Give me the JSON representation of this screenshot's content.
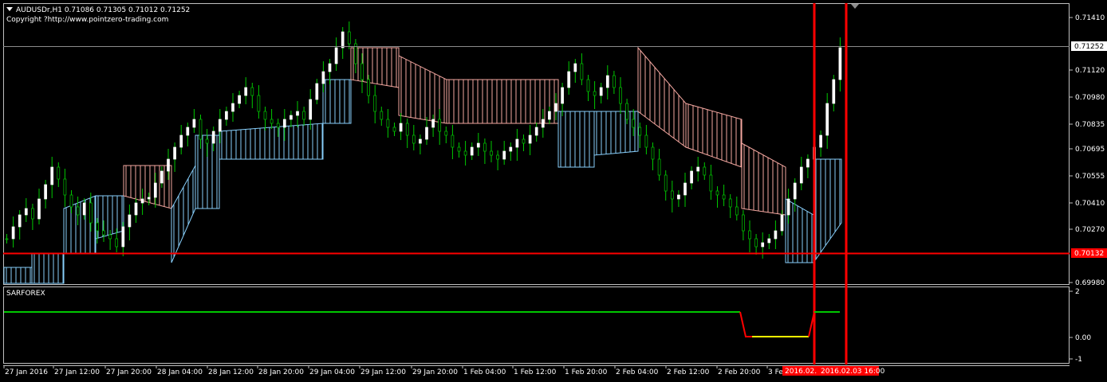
{
  "header": {
    "symbol_line": "AUDUSDr,H1  0.71086 0.71305 0.71012 0.71252",
    "copyright": "Copyright ?http://www.pointzero-trading.com"
  },
  "subwindow": {
    "name": "SARFOREX",
    "axis_labels": [
      "2",
      "0.00",
      "-1"
    ],
    "values": [
      {
        "label": "2",
        "v": 2
      },
      {
        "label": "0.00",
        "v": 0
      },
      {
        "label": "-1",
        "v": -1
      }
    ]
  },
  "price_axis": {
    "labels": [
      "0.71410",
      "0.71120",
      "0.70980",
      "0.70835",
      "0.70695",
      "0.70555",
      "0.70410",
      "0.70270",
      "0.69980"
    ]
  },
  "current_price_label": "0.71252",
  "hline_label": "0.70132",
  "time_axis": {
    "labels": [
      "27 Jan 2016",
      "27 Jan 12:00",
      "27 Jan 20:00",
      "28 Jan 04:00",
      "28 Jan 12:00",
      "28 Jan 20:00",
      "29 Jan 04:00",
      "29 Jan 12:00",
      "29 Jan 20:00",
      "1 Feb 04:00",
      "1 Feb 12:00",
      "1 Feb 20:00",
      "2 Feb 04:00",
      "2 Feb 12:00",
      "2 Feb 20:00",
      "3 Fe"
    ],
    "highlight_labels": [
      "2016.02.",
      "2016.02.03 16:00"
    ]
  },
  "colors": {
    "background": "#000000",
    "bull_candle": "#ffffff",
    "wick": "#00c800",
    "cloud_bull": "#87cefa",
    "cloud_bear": "#f4a7a0",
    "red_line": "#ff0000",
    "indicator_green": "#00c800",
    "indicator_yellow": "#ffff00",
    "indicator_red": "#ff0000"
  },
  "chart_data": {
    "type": "candlestick",
    "ylim": [
      0.6998,
      0.7148
    ],
    "horizontal_line": 0.70132,
    "current_price": 0.71252
  }
}
